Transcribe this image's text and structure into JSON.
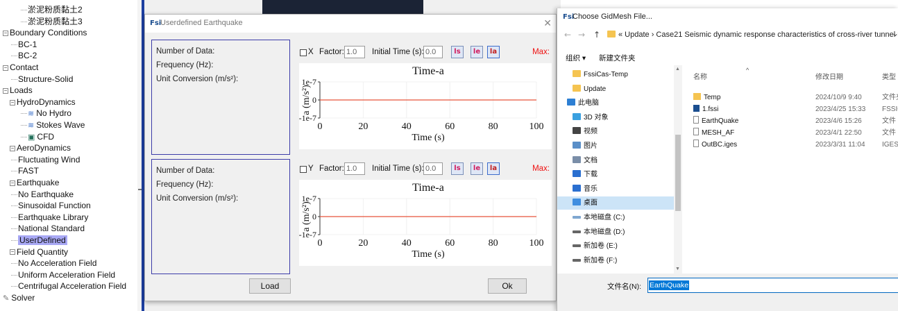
{
  "tree": {
    "items": [
      {
        "label": "淤泥粉质黏土2",
        "depth": 3,
        "expander": "",
        "icon": ""
      },
      {
        "label": "淤泥粉质黏土3",
        "depth": 3,
        "expander": "",
        "icon": ""
      },
      {
        "label": "Boundary Conditions",
        "depth": 0,
        "expander": "−",
        "icon": ""
      },
      {
        "label": "BC-1",
        "depth": 2,
        "expander": "",
        "icon": ""
      },
      {
        "label": "BC-2",
        "depth": 2,
        "expander": "",
        "icon": ""
      },
      {
        "label": "Contact",
        "depth": 0,
        "expander": "−",
        "icon": ""
      },
      {
        "label": "Structure-Solid",
        "depth": 2,
        "expander": "",
        "icon": ""
      },
      {
        "label": "Loads",
        "depth": 0,
        "expander": "−",
        "icon": ""
      },
      {
        "label": "HydroDynamics",
        "depth": 1,
        "expander": "−",
        "icon": ""
      },
      {
        "label": "No Hydro",
        "depth": 3,
        "expander": "",
        "icon": "≋"
      },
      {
        "label": "Stokes Wave",
        "depth": 3,
        "expander": "",
        "icon": "≋"
      },
      {
        "label": "CFD",
        "depth": 3,
        "expander": "",
        "icon": "▣"
      },
      {
        "label": "AeroDynamics",
        "depth": 1,
        "expander": "−",
        "icon": ""
      },
      {
        "label": "Fluctuating Wind",
        "depth": 2,
        "expander": "",
        "icon": ""
      },
      {
        "label": "FAST",
        "depth": 2,
        "expander": "",
        "icon": ""
      },
      {
        "label": "Earthquake",
        "depth": 1,
        "expander": "−",
        "icon": ""
      },
      {
        "label": "No Earthquake",
        "depth": 2,
        "expander": "",
        "icon": ""
      },
      {
        "label": "Sinusoidal Function",
        "depth": 2,
        "expander": "",
        "icon": ""
      },
      {
        "label": "Earthquake Library",
        "depth": 2,
        "expander": "",
        "icon": ""
      },
      {
        "label": "National Standard",
        "depth": 2,
        "expander": "",
        "icon": ""
      },
      {
        "label": "UserDefined",
        "depth": 2,
        "expander": "",
        "icon": "",
        "selected": true
      },
      {
        "label": "Field Quantity",
        "depth": 1,
        "expander": "−",
        "icon": ""
      },
      {
        "label": "No Acceleration Field",
        "depth": 2,
        "expander": "",
        "icon": ""
      },
      {
        "label": "Uniform Acceleration Field",
        "depth": 2,
        "expander": "",
        "icon": ""
      },
      {
        "label": "Centrifugal Acceleration Field",
        "depth": 2,
        "expander": "",
        "icon": ""
      },
      {
        "label": "Solver",
        "depth": 0,
        "expander": "",
        "icon": "✎"
      }
    ]
  },
  "eq_dialog": {
    "title": "Userdefined Earthquake",
    "app_icon": "Fsi",
    "close": "✕",
    "panels": [
      {
        "info": {
          "num_data": "Number of Data:",
          "frequency": "Frequency (Hz):",
          "unit_conversion": "Unit Conversion (m/s²):"
        },
        "axis": "X",
        "factor_label": "Factor:",
        "factor_value": "1.0",
        "initial_time_label": "Initial Time (s):",
        "initial_time_value": "0.0",
        "max_label": "Max:"
      },
      {
        "info": {
          "num_data": "Number of Data:",
          "frequency": "Frequency (Hz):",
          "unit_conversion": "Unit Conversion (m/s²):"
        },
        "axis": "Y",
        "factor_label": "Factor:",
        "factor_value": "1.0",
        "initial_time_label": "Initial Time (s):",
        "initial_time_value": "0.0",
        "max_label": "Max:"
      }
    ],
    "load_button": "Load",
    "ok_button": "Ok"
  },
  "chart_data": [
    {
      "type": "line",
      "title": "Time-a",
      "xlabel": "Time (s)",
      "ylabel": "a (m/s²)",
      "x": [
        0,
        100
      ],
      "y": [
        0,
        0
      ],
      "xlim": [
        0,
        100
      ],
      "ylim": [
        -1e-07,
        1e-07
      ],
      "xticks": [
        "0",
        "20",
        "40",
        "60",
        "80",
        "100"
      ],
      "yticks": [
        "1e-7",
        "0",
        "-1e-7"
      ],
      "line_color": "#e8533a",
      "grid": true
    },
    {
      "type": "line",
      "title": "Time-a",
      "xlabel": "Time (s)",
      "ylabel": "a (m/s²)",
      "x": [
        0,
        100
      ],
      "y": [
        0,
        0
      ],
      "xlim": [
        0,
        100
      ],
      "ylim": [
        -1e-07,
        1e-07
      ],
      "xticks": [
        "0",
        "20",
        "40",
        "60",
        "80",
        "100"
      ],
      "yticks": [
        "1e-7",
        "0",
        "-1e-7"
      ],
      "line_color": "#e8533a",
      "grid": true
    }
  ],
  "file_dialog": {
    "title": "Choose GidMesh File...",
    "app_icon": "Fsi",
    "nav": {
      "back": "←",
      "forward": "→",
      "up": "↑"
    },
    "address": "« Update › Case21 Seismic dynamic response characteristics of cross-river tunnel ›",
    "address_dropdown": "⌄",
    "toolbar": {
      "organize": "组织 ▾",
      "new_folder": "新建文件夹"
    },
    "nav_pane": [
      {
        "label": "FssiCas-Temp",
        "icon": "folder",
        "indent": 1
      },
      {
        "label": "Update",
        "icon": "folder",
        "indent": 1
      },
      {
        "label": "此电脑",
        "icon": "pc",
        "indent": 0
      },
      {
        "label": "3D 对象",
        "icon": "cube",
        "indent": 1
      },
      {
        "label": "视频",
        "icon": "video",
        "indent": 1
      },
      {
        "label": "图片",
        "icon": "picture",
        "indent": 1
      },
      {
        "label": "文档",
        "icon": "document",
        "indent": 1
      },
      {
        "label": "下载",
        "icon": "download",
        "indent": 1
      },
      {
        "label": "音乐",
        "icon": "music",
        "indent": 1
      },
      {
        "label": "桌面",
        "icon": "desktop",
        "indent": 1,
        "selected": true
      },
      {
        "label": "本地磁盘 (C:)",
        "icon": "drive-c",
        "indent": 1
      },
      {
        "label": "本地磁盘 (D:)",
        "icon": "drive",
        "indent": 1
      },
      {
        "label": "新加卷 (E:)",
        "icon": "drive",
        "indent": 1
      },
      {
        "label": "新加卷 (F:)",
        "icon": "drive",
        "indent": 1
      }
    ],
    "columns": {
      "name": "名称",
      "date": "修改日期",
      "type": "类型"
    },
    "files": [
      {
        "name": "Temp",
        "date": "2024/10/9 9:40",
        "type": "文件夹",
        "icon": "folder"
      },
      {
        "name": "1.fssi",
        "date": "2023/4/25 15:33",
        "type": "FSSIC",
        "icon": "fssi"
      },
      {
        "name": "EarthQuake",
        "date": "2023/4/6 15:26",
        "type": "文件",
        "icon": "file"
      },
      {
        "name": "MESH_AF",
        "date": "2023/4/1 22:50",
        "type": "文件",
        "icon": "file"
      },
      {
        "name": "OutBC.iges",
        "date": "2023/3/31 11:04",
        "type": "IGES",
        "icon": "file"
      }
    ],
    "filename_label": "文件名(N):",
    "filename_value": "EarthQuake"
  },
  "colors": {
    "selection": "#a9a9f5",
    "dialog_bg": "#f0f0f0",
    "info_border": "#3c3ca8",
    "max_label": "#e11111",
    "plot_line": "#e8533a",
    "file_selected": "#cce4f7",
    "folder": "#f5c451"
  }
}
